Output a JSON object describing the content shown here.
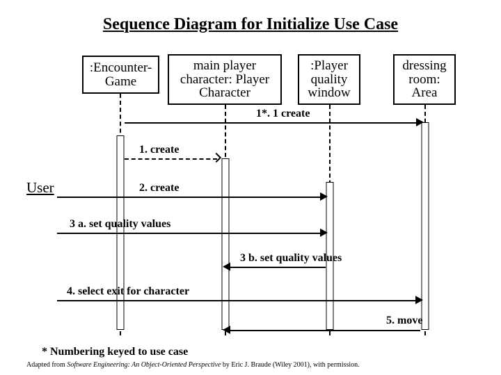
{
  "title": "Sequence Diagram for Initialize Use Case",
  "participants": {
    "p1": ":Encounter-\nGame",
    "p2": "main player character: Player Character",
    "p3": ":Player quality window",
    "p4": "dressing room: Area"
  },
  "actor": "User",
  "messages": {
    "m0": "1*. 1 create",
    "m1": "1. create",
    "m2": "2. create",
    "m3a": "3 a. set quality values",
    "m3b": "3 b. set quality values",
    "m4": "4. select exit for character",
    "m5": "5. move"
  },
  "footnote": "* Numbering keyed to use case",
  "citation_prefix": "Adapted from ",
  "citation_em": "Software Engineering: An Object-Oriented Perspective",
  "citation_suffix": " by Eric J. Braude (Wiley 2001), with permission."
}
